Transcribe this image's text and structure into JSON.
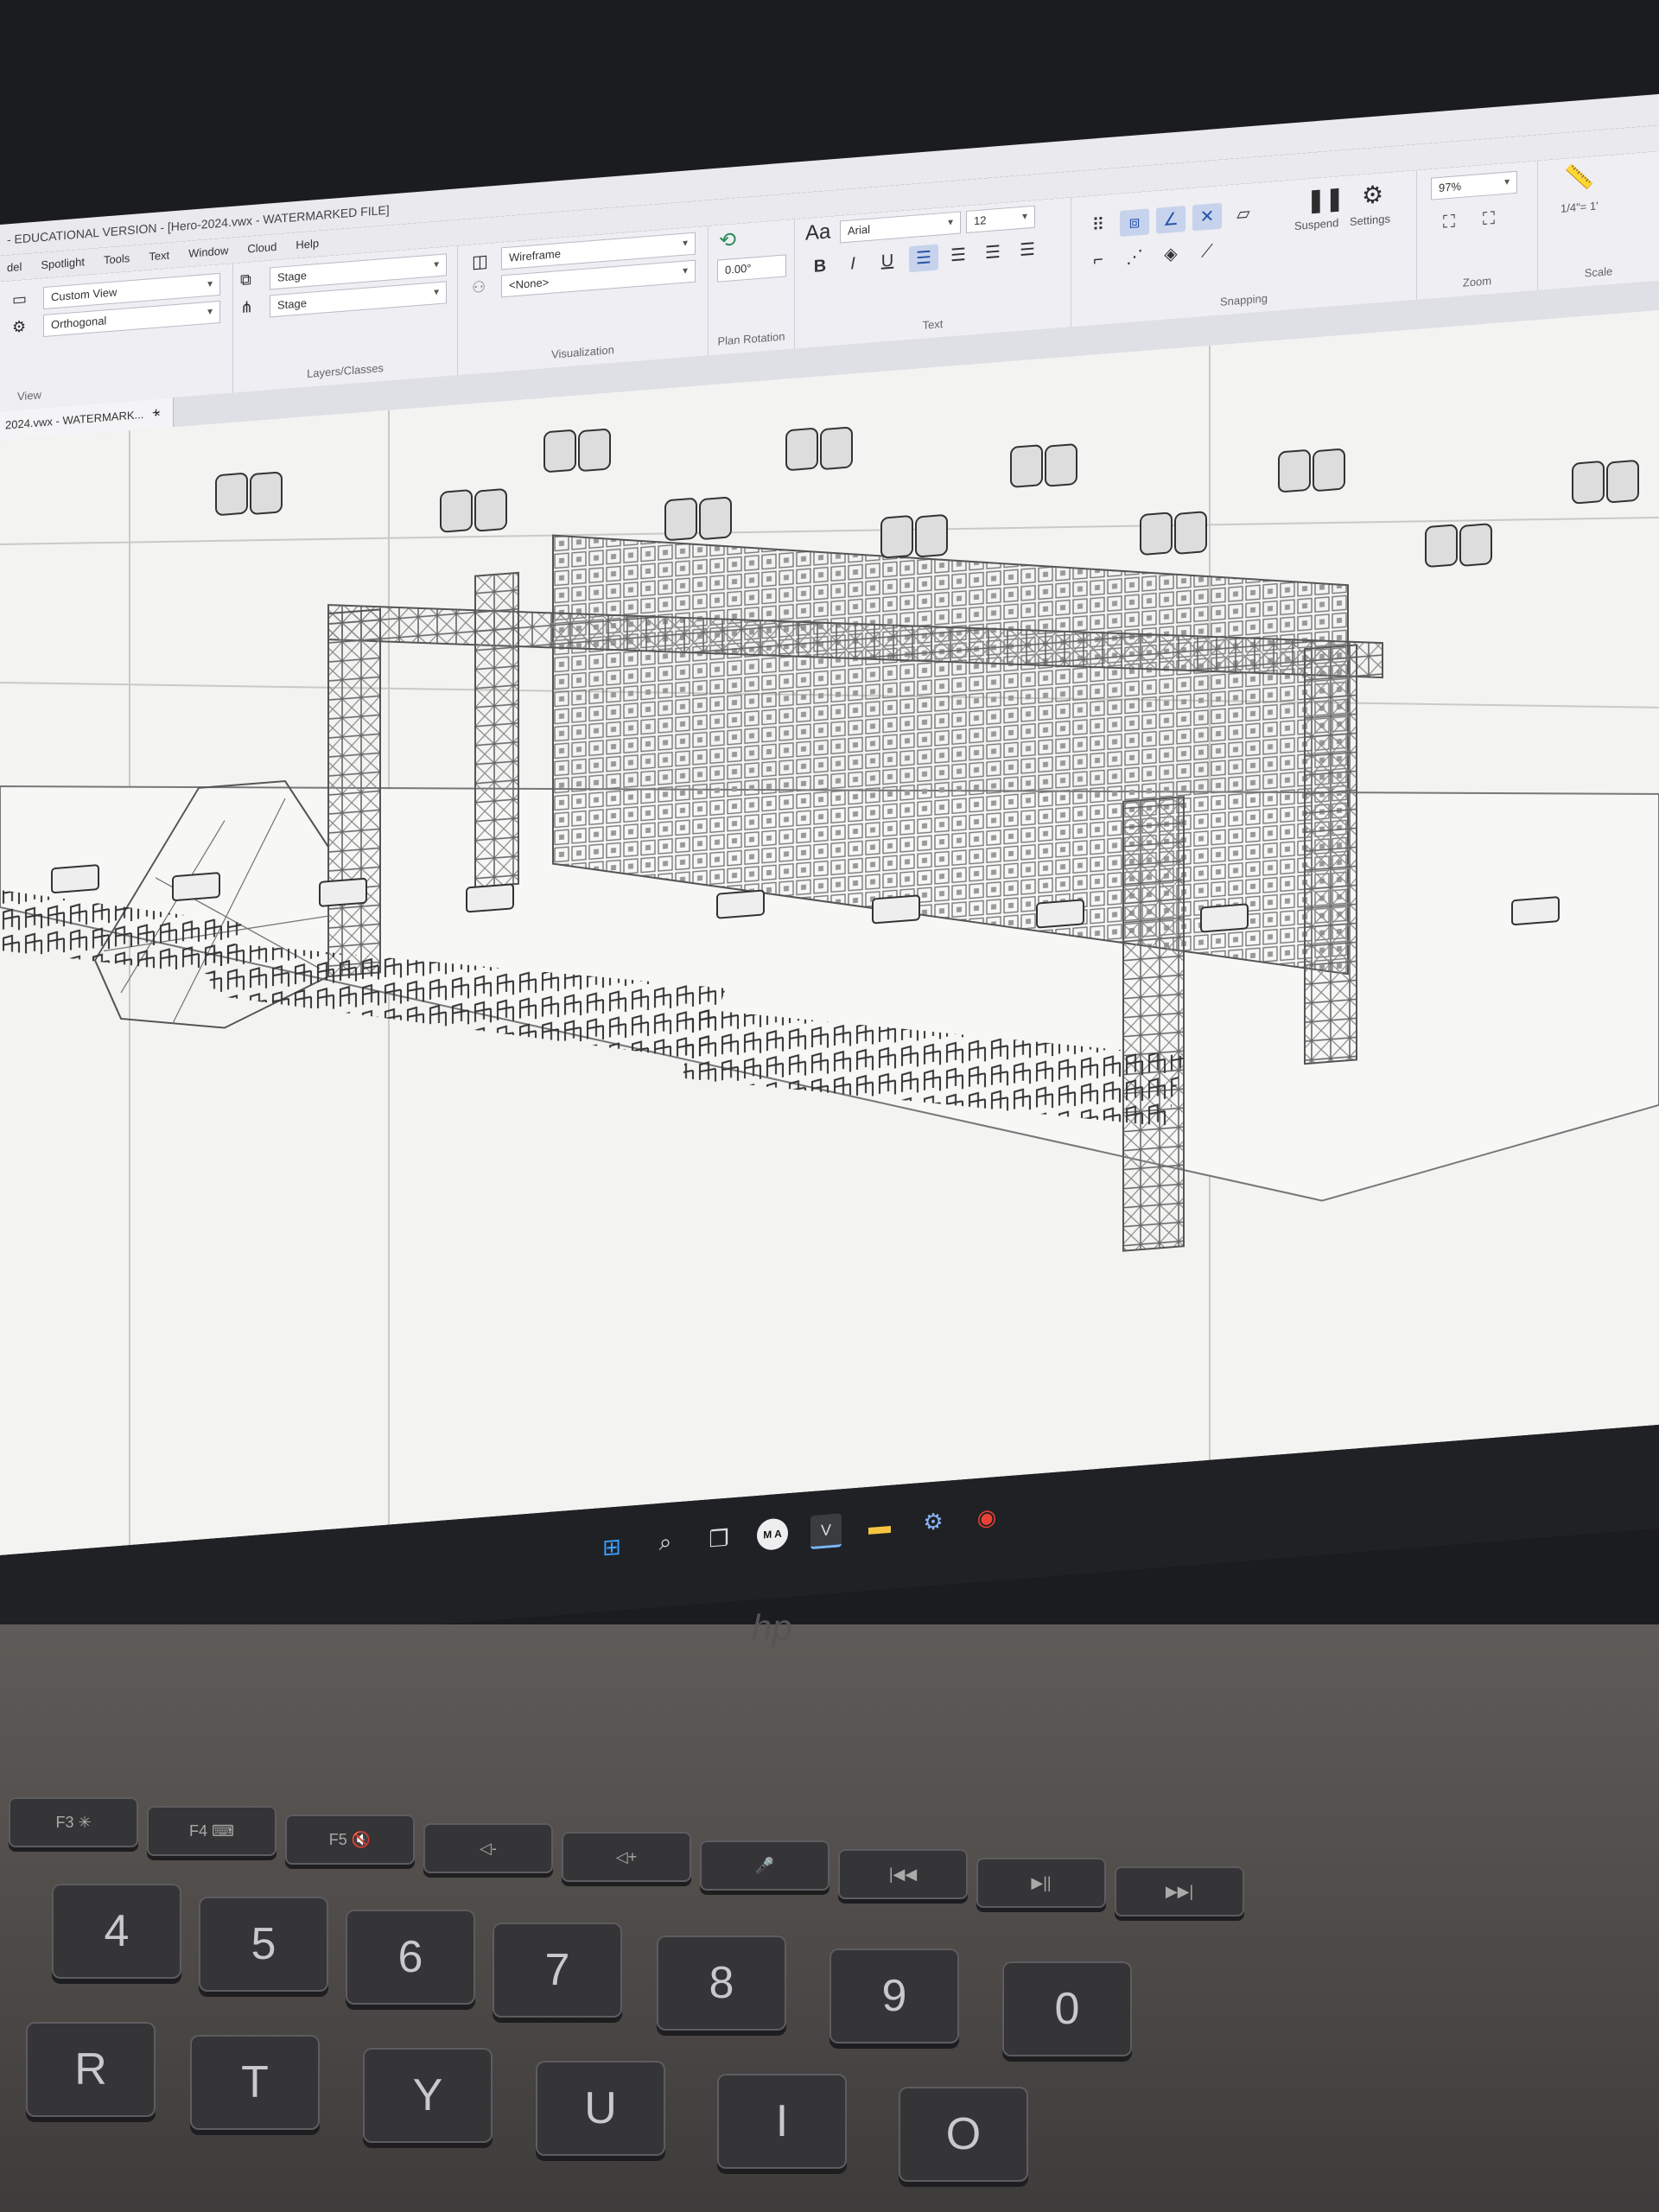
{
  "window": {
    "title": "- EDUCATIONAL VERSION - [Hero-2024.vwx - WATERMARKED FILE]"
  },
  "menu": [
    "del",
    "Spotlight",
    "Tools",
    "Text",
    "Window",
    "Cloud",
    "Help"
  ],
  "ribbon": {
    "view": {
      "view_value": "Custom View",
      "projection_value": "Orthogonal",
      "label": "View"
    },
    "layers": {
      "layer_value": "Stage",
      "class_value": "Stage",
      "label": "Layers/Classes"
    },
    "visualization": {
      "render_value": "Wireframe",
      "none_value": "<None>",
      "label": "Visualization"
    },
    "plan_rotation": {
      "value": "0.00°",
      "label": "Plan Rotation"
    },
    "text": {
      "font_icon": "Aa",
      "font_value": "Arial",
      "size_value": "12",
      "bold": "B",
      "italic": "I",
      "underline": "U",
      "label": "Text"
    },
    "snapping": {
      "suspend_label": "Suspend",
      "settings_label": "Settings",
      "label": "Snapping"
    },
    "zoom": {
      "value": "97%",
      "label": "Zoom"
    },
    "scale": {
      "value": "1/4\"= 1'",
      "label": "Scale"
    }
  },
  "document_tab": {
    "label": "2024.vwx - WATERMARK...",
    "close": "×",
    "add": "+"
  },
  "taskbar": {
    "icons": [
      "windows-start-icon",
      "search-icon",
      "task-view-icon",
      "ma-app-icon",
      "vectorworks-icon",
      "file-explorer-icon",
      "settings-icon",
      "chrome-icon"
    ],
    "ma_label": "M A",
    "vw_label": "V"
  },
  "keyboard": {
    "fn_row": [
      "F3 ✳",
      "F4 ⌨",
      "F5 🔇",
      "◁-",
      "◁+",
      "🎤",
      "|◀◀",
      "▶||",
      "▶▶|"
    ],
    "number_row": [
      "4",
      "5",
      "6",
      "7",
      "8",
      "9",
      "0"
    ],
    "letter_row": [
      "R",
      "T",
      "Y",
      "U",
      "I",
      "O"
    ],
    "brand": "hp"
  }
}
